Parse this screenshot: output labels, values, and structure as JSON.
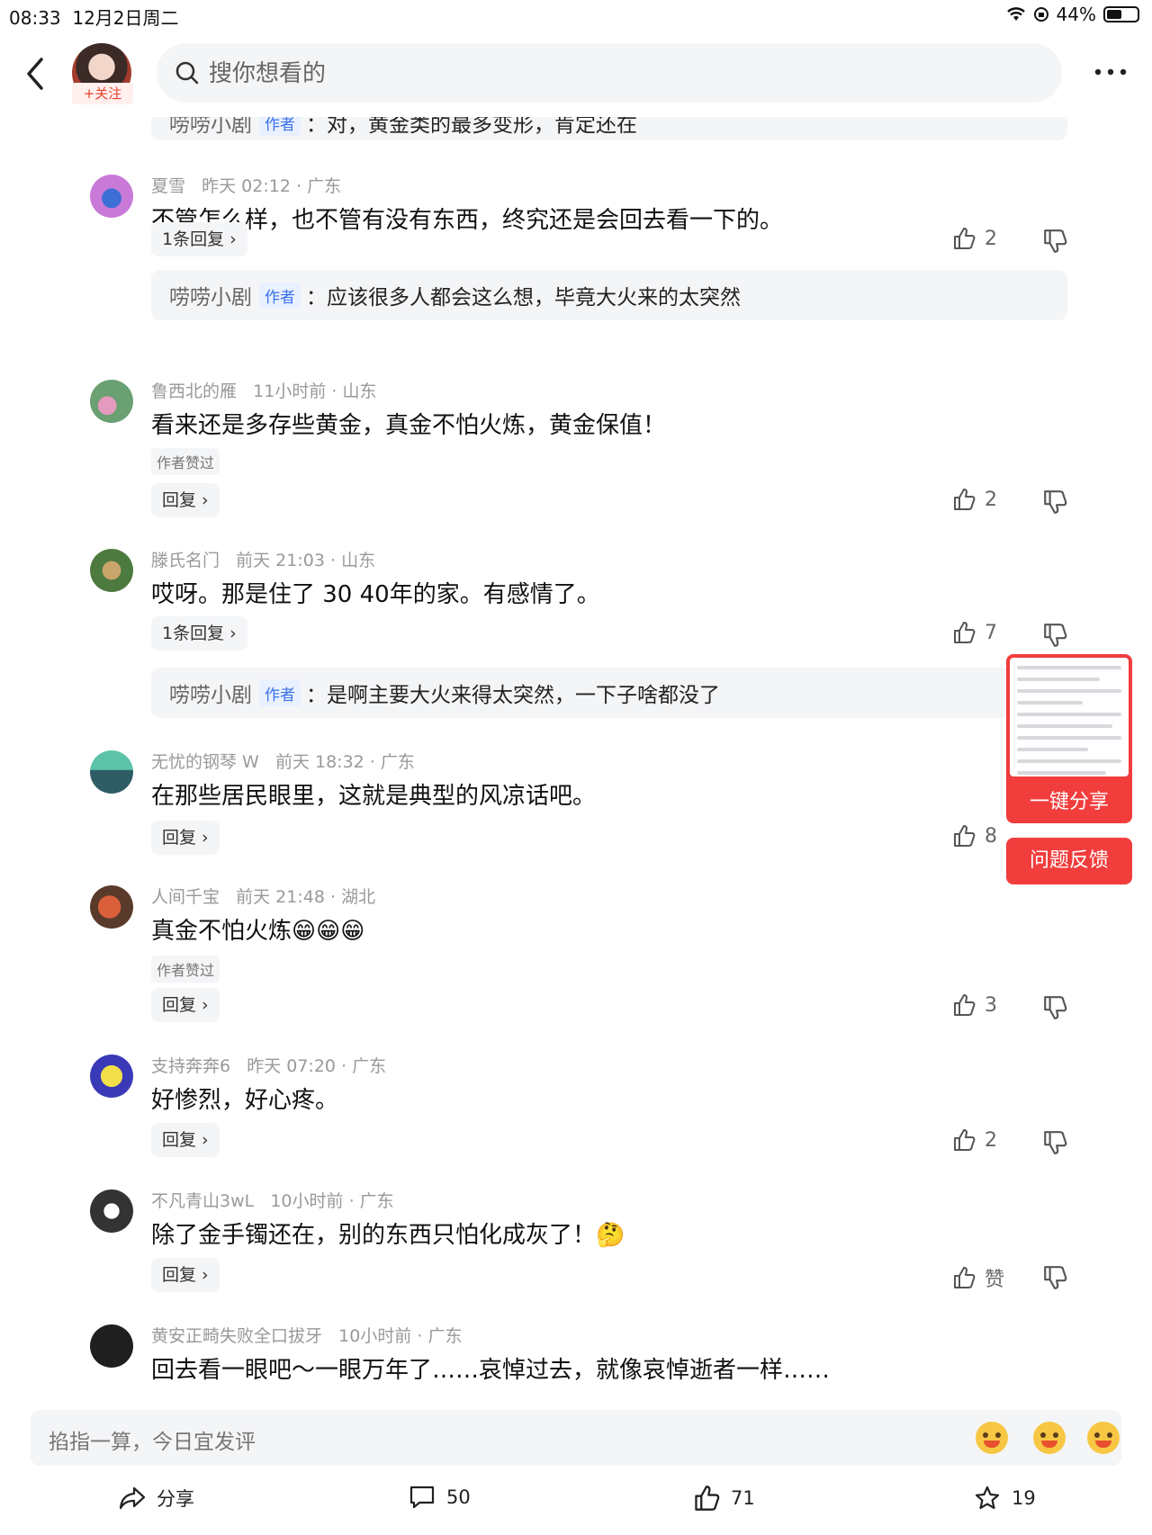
{
  "status_bar": {
    "time": "08:33",
    "date": "12月2日周二",
    "battery": "44%"
  },
  "header": {
    "follow_label": "+关注",
    "search_placeholder": "搜你想看的"
  },
  "top_reply": {
    "author": "唠唠小剧",
    "tag": "作者",
    "text": "：对，黄金类的最多变形，肯定还在"
  },
  "comments": [
    {
      "user": "夏雪",
      "time": "昨天 02:12",
      "region": "广东",
      "text": "不管怎么样，也不管有没有东西，终究还是会回去看一下的。",
      "reply_label": "1条回复 ›",
      "likes": "2",
      "author_liked": false,
      "author_reply": {
        "author": "唠唠小剧",
        "tag": "作者",
        "text": "：应该很多人都会这么想，毕竟大火来的太突然"
      }
    },
    {
      "user": "鲁西北的雁",
      "time": "11小时前",
      "region": "山东",
      "text": "看来还是多存些黄金，真金不怕火炼，黄金保值！",
      "reply_label": "回复 ›",
      "likes": "2",
      "author_liked": true,
      "liked_label": "作者赞过"
    },
    {
      "user": "滕氏名门",
      "time": "前天 21:03",
      "region": "山东",
      "text": "哎呀。那是住了 30 40年的家。有感情了。",
      "reply_label": "1条回复 ›",
      "likes": "7",
      "author_liked": false,
      "author_reply": {
        "author": "唠唠小剧",
        "tag": "作者",
        "text": "：是啊主要大火来得太突然，一下子啥都没了"
      }
    },
    {
      "user": "无忧的钢琴 W",
      "time": "前天 18:32",
      "region": "广东",
      "text": "在那些居民眼里，这就是典型的风凉话吧。",
      "reply_label": "回复 ›",
      "likes": "8",
      "author_liked": false
    },
    {
      "user": "人间千宝",
      "time": "前天 21:48",
      "region": "湖北",
      "text": "真金不怕火炼😁😁😁",
      "reply_label": "回复 ›",
      "likes": "3",
      "author_liked": true,
      "liked_label": "作者赞过"
    },
    {
      "user": "支持奔奔6",
      "time": "昨天 07:20",
      "region": "广东",
      "text": "好惨烈，好心疼。",
      "reply_label": "回复 ›",
      "likes": "2",
      "author_liked": false
    },
    {
      "user": "不凡青山3wL",
      "time": "10小时前",
      "region": "广东",
      "text": "除了金手镯还在，别的东西只怕化成灰了！🤔",
      "reply_label": "回复 ›",
      "likes": "赞",
      "author_liked": false
    },
    {
      "user": "黄安正畸失败全口拔牙",
      "time": "10小时前",
      "region": "广东",
      "text": "回去看一眼吧～一眼万年了……哀悼过去，就像哀悼逝者一样……"
    }
  ],
  "floating": {
    "share_label": "一键分享",
    "feedback_label": "问题反馈"
  },
  "bottom": {
    "input_placeholder": "掐指一算，今日宜发评",
    "share_label": "分享",
    "comments_count": "50",
    "likes_count": "71",
    "favorites_count": "19"
  },
  "colors": {
    "accent_red": "#f23d3d",
    "author_tag_blue": "#3a72e8",
    "meta_gray": "#999999"
  },
  "icons": [
    "back-icon",
    "search-icon",
    "more-icon",
    "thumbs-up-icon",
    "thumbs-down-icon",
    "share-icon",
    "comment-icon",
    "star-icon"
  ]
}
